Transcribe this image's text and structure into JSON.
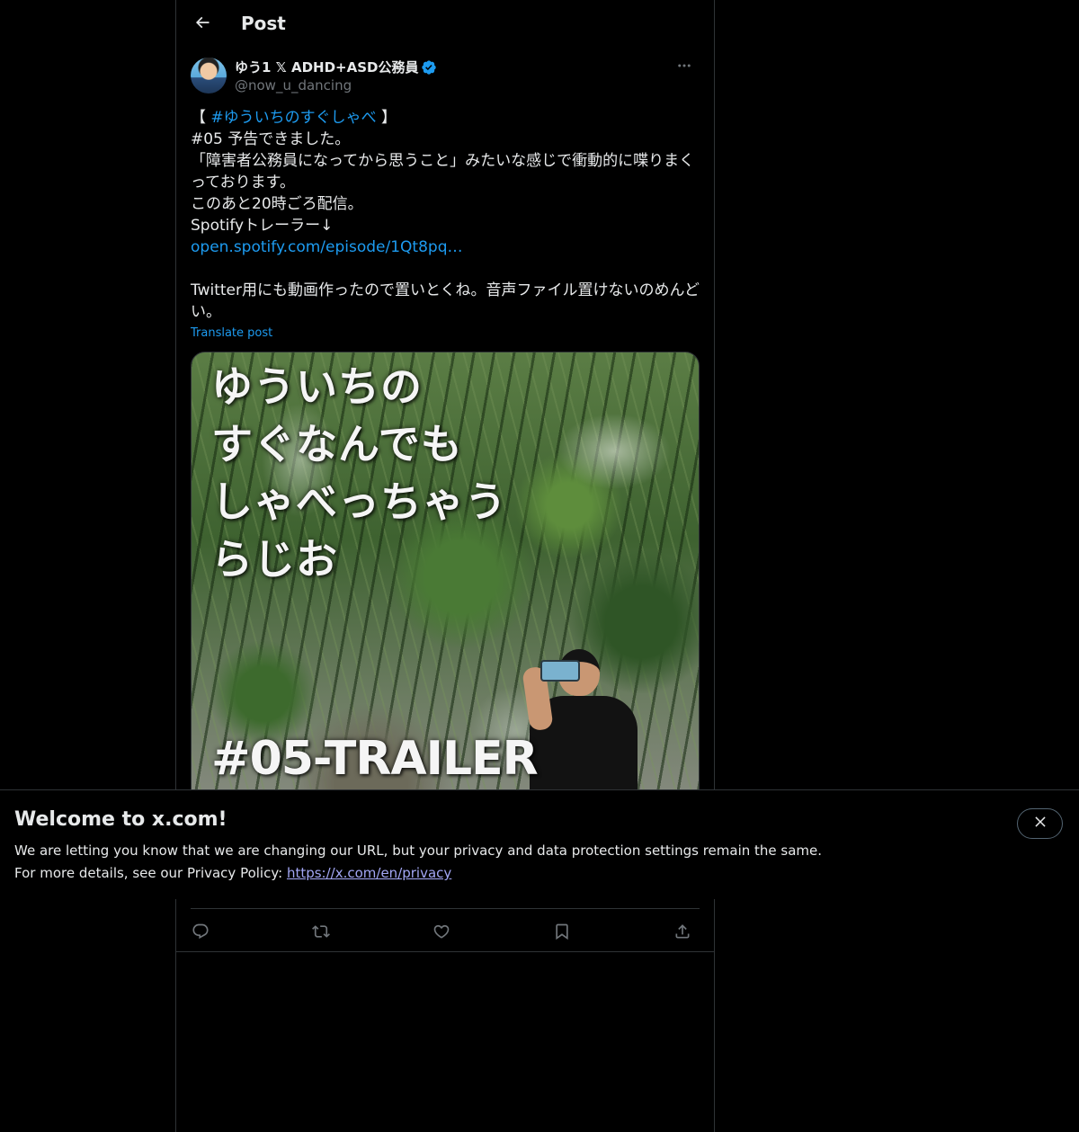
{
  "header": {
    "title": "Post",
    "back_icon": "arrow-left-icon"
  },
  "author": {
    "display_name": "ゆう1 𝕏 ADHD+ASD公務員",
    "handle": "@now_u_dancing",
    "verified": true,
    "verified_color": "#1d9bf0"
  },
  "tweet": {
    "hashtag_prefix": "【 ",
    "hashtag": "#ゆういちのすぐしゃべ",
    "hashtag_suffix": " 】",
    "line2": "#05 予告できました。",
    "line3": "「障害者公務員になってから思うこと」みたいな感じで衝動的に喋りまくっております。",
    "line4": "このあと20時ごろ配信。",
    "line5": "Spotifyトレーラー↓",
    "link": "open.spotify.com/episode/1Qt8pq…",
    "line7": "Twitter用にも動画作ったので置いとくね。音声ファイル置けないのめんどい。",
    "translate_label": "Translate post"
  },
  "media": {
    "title_lines": [
      "ゆういちの",
      "すぐなんでも",
      "しゃべっちゃう",
      "らじお"
    ],
    "episode_label": "#05-TRAILER"
  },
  "actions": {
    "reply_icon": "reply-icon",
    "repost_icon": "repost-icon",
    "like_icon": "heart-icon",
    "bookmark_icon": "bookmark-icon",
    "share_icon": "share-icon"
  },
  "banner": {
    "title": "Welcome to x.com!",
    "line1": "We are letting you know that we are changing our URL, but your privacy and data protection settings remain the same.",
    "line2_prefix": "For more details, see our Privacy Policy: ",
    "privacy_link": "https://x.com/en/privacy"
  },
  "colors": {
    "background": "#000000",
    "text": "#e7e9ea",
    "secondary_text": "#71767b",
    "accent": "#1d9bf0",
    "border": "#2f3336",
    "banner_link": "#a3a7f5"
  }
}
